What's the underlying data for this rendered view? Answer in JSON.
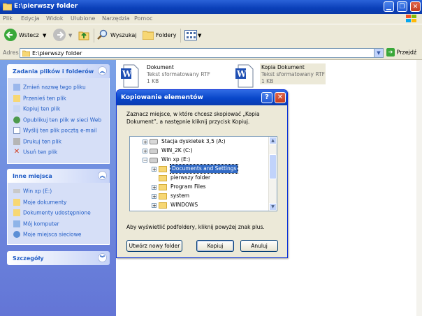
{
  "window": {
    "title": "E:\\pierwszy folder"
  },
  "menu": [
    "Plik",
    "Edycja",
    "Widok",
    "Ulubione",
    "Narzędzia",
    "Pomoc"
  ],
  "toolbar": {
    "back": "Wstecz",
    "search": "Wyszukaj",
    "folders": "Foldery"
  },
  "address": {
    "label": "Adres",
    "value": "E:\\pierwszy folder",
    "go": "Przejdź"
  },
  "tasks_panel": {
    "title": "Zadania plików i folderów",
    "items": [
      "Zmień nazwę tego pliku",
      "Przenieś ten plik",
      "Kopiuj ten plik",
      "Opublikuj ten plik w sieci Web",
      "Wyślij ten plik pocztą e-mail",
      "Drukuj ten plik",
      "Usuń ten plik"
    ]
  },
  "places_panel": {
    "title": "Inne miejsca",
    "items": [
      "Win xp (E:)",
      "Moje dokumenty",
      "Dokumenty udostępnione",
      "Mój komputer",
      "Moje miejsca sieciowe"
    ]
  },
  "details_panel": {
    "title": "Szczegóły"
  },
  "files": [
    {
      "name": "Dokument",
      "type": "Tekst sformatowany RTF",
      "size": "1 KB"
    },
    {
      "name": "Kopia Dokument",
      "type": "Tekst sformatowany RTF",
      "size": "1 KB"
    }
  ],
  "dialog": {
    "title": "Kopiowanie elementów",
    "help_glyph": "?",
    "close_glyph": "✕",
    "instruction": "Zaznacz miejsce, w które chcesz skopiować „Kopia Dokument”, a następnie kliknij przycisk Kopiuj.",
    "tree": [
      {
        "label": "Stacja dyskietek 3,5 (A:)",
        "level": 1,
        "kind": "floppy",
        "expander": "+"
      },
      {
        "label": "WIN_2K (C:)",
        "level": 1,
        "kind": "drive",
        "expander": "+"
      },
      {
        "label": "Win xp (E:)",
        "level": 1,
        "kind": "drive",
        "expander": "−"
      },
      {
        "label": "Documents and Settings",
        "level": 2,
        "kind": "folder",
        "expander": "+",
        "selected": true
      },
      {
        "label": "pierwszy folder",
        "level": 2,
        "kind": "folder",
        "expander": ""
      },
      {
        "label": "Program Files",
        "level": 2,
        "kind": "folder",
        "expander": "+"
      },
      {
        "label": "system",
        "level": 2,
        "kind": "folder",
        "expander": "+"
      },
      {
        "label": "WINDOWS",
        "level": 2,
        "kind": "folder",
        "expander": "+"
      }
    ],
    "hint": "Aby wyświetlić podfoldery, kliknij powyżej znak plus.",
    "new_folder": "Utwórz nowy folder",
    "copy": "Kopiuj",
    "cancel": "Anuluj"
  },
  "colors": {
    "titlebar": "#0a3fb8",
    "panel_link": "#215dc6",
    "selection": "#316ac5",
    "left_pane": "#7ba2e7"
  }
}
